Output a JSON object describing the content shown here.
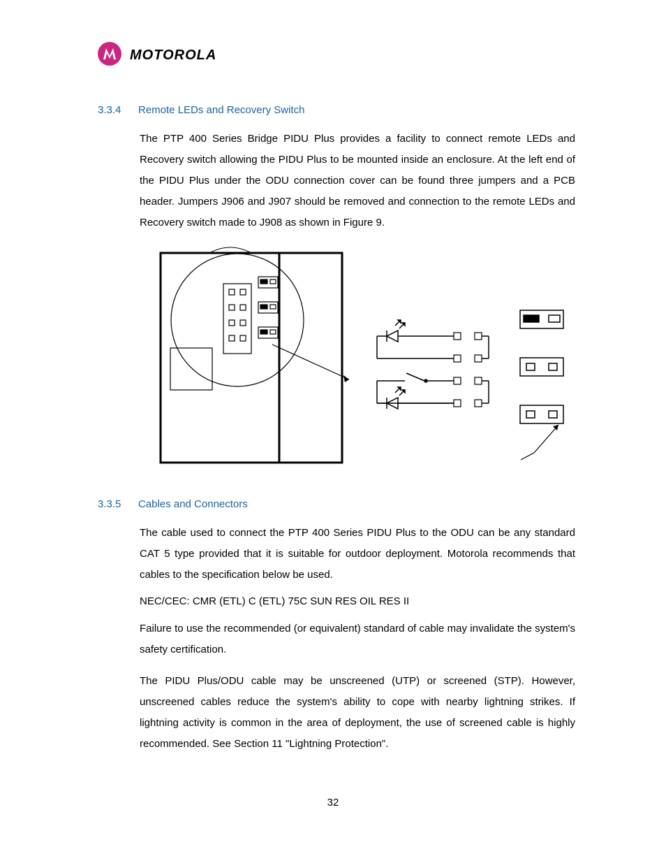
{
  "brand": {
    "name": "MOTOROLA"
  },
  "section1": {
    "num": "3.3.4",
    "title": "Remote LEDs and Recovery Switch",
    "para1": "The PTP 400 Series Bridge PIDU Plus provides a facility to connect remote LEDs and Recovery switch allowing the PIDU Plus to be mounted inside an enclosure. At the left end of the PIDU Plus under the ODU connection cover can be found three jumpers and a PCB header. Jumpers J906 and J907 should be removed and connection to the remote LEDs and Recovery switch made to J908 as shown in Figure 9."
  },
  "section2": {
    "num": "3.3.5",
    "title": "Cables and Connectors",
    "para1": "The cable used to connect the PTP 400 Series PIDU Plus to the ODU can be any standard CAT 5 type provided that it is suitable for outdoor deployment. Motorola recommends that cables to the specification below be used.",
    "spec": "NEC/CEC: CMR (ETL) C (ETL) 75C SUN RES OIL RES II",
    "para2": "Failure to use the recommended (or equivalent) standard of cable may invalidate the system's safety certification.",
    "para3": "The PIDU Plus/ODU cable may be unscreened (UTP) or screened (STP). However, unscreened cables reduce the system's ability to cope with nearby lightning strikes. If lightning activity is common in the area of deployment, the use of screened cable is highly recommended. See Section 11 \"Lightning Protection\"."
  },
  "pageNumber": "32"
}
